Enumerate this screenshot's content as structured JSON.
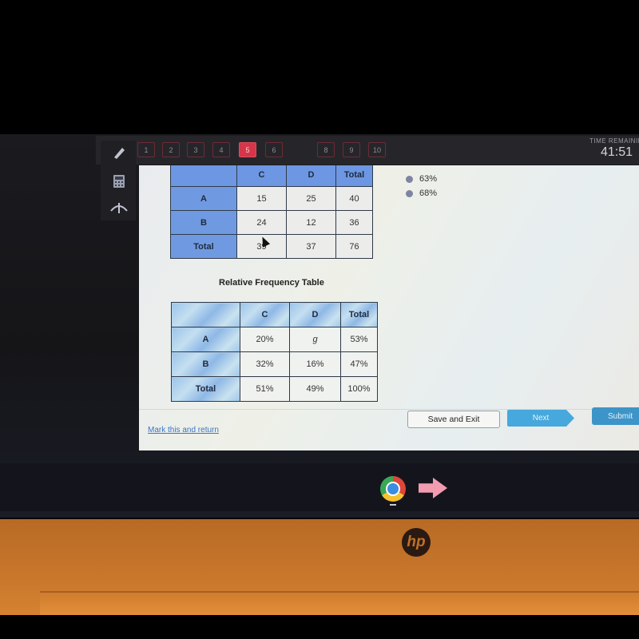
{
  "toolbar": {
    "tools": [
      {
        "name": "pencil",
        "icon": "pencil-icon"
      },
      {
        "name": "calculator",
        "icon": "calculator-icon"
      },
      {
        "name": "reference",
        "icon": "compass-icon"
      }
    ],
    "questions": [
      "1",
      "2",
      "3",
      "4",
      "5",
      "6",
      "8",
      "9",
      "10"
    ],
    "active_question": "5",
    "timer_label": "TIME REMAINING",
    "timer": "41:51"
  },
  "frequency_table": {
    "headers": [
      "",
      "C",
      "D",
      "Total"
    ],
    "rows": [
      {
        "label": "A",
        "values": [
          "15",
          "25",
          "40"
        ]
      },
      {
        "label": "B",
        "values": [
          "24",
          "12",
          "36"
        ]
      },
      {
        "label": "Total",
        "values": [
          "39",
          "37",
          "76"
        ]
      }
    ]
  },
  "relative_table": {
    "title": "Relative Frequency Table",
    "headers": [
      "",
      "C",
      "D",
      "Total"
    ],
    "rows": [
      {
        "label": "A",
        "values": [
          "20%",
          "g",
          "53%"
        ]
      },
      {
        "label": "B",
        "values": [
          "32%",
          "16%",
          "47%"
        ]
      },
      {
        "label": "Total",
        "values": [
          "51%",
          "49%",
          "100%"
        ]
      }
    ]
  },
  "answer_options": [
    "63%",
    "68%"
  ],
  "footer": {
    "mark_link": "Mark this and return",
    "save_exit": "Save and Exit",
    "next": "Next",
    "submit": "Submit"
  },
  "taskbar": {
    "apps": [
      "chrome-icon",
      "arrow-app-icon"
    ]
  },
  "device": {
    "brand": "hp"
  },
  "colors": {
    "active_question": "#d6364a",
    "table_header": "#6d97e3",
    "next_button": "#46a8dc",
    "submit_button": "#3d94c8",
    "link": "#3a76c4"
  }
}
